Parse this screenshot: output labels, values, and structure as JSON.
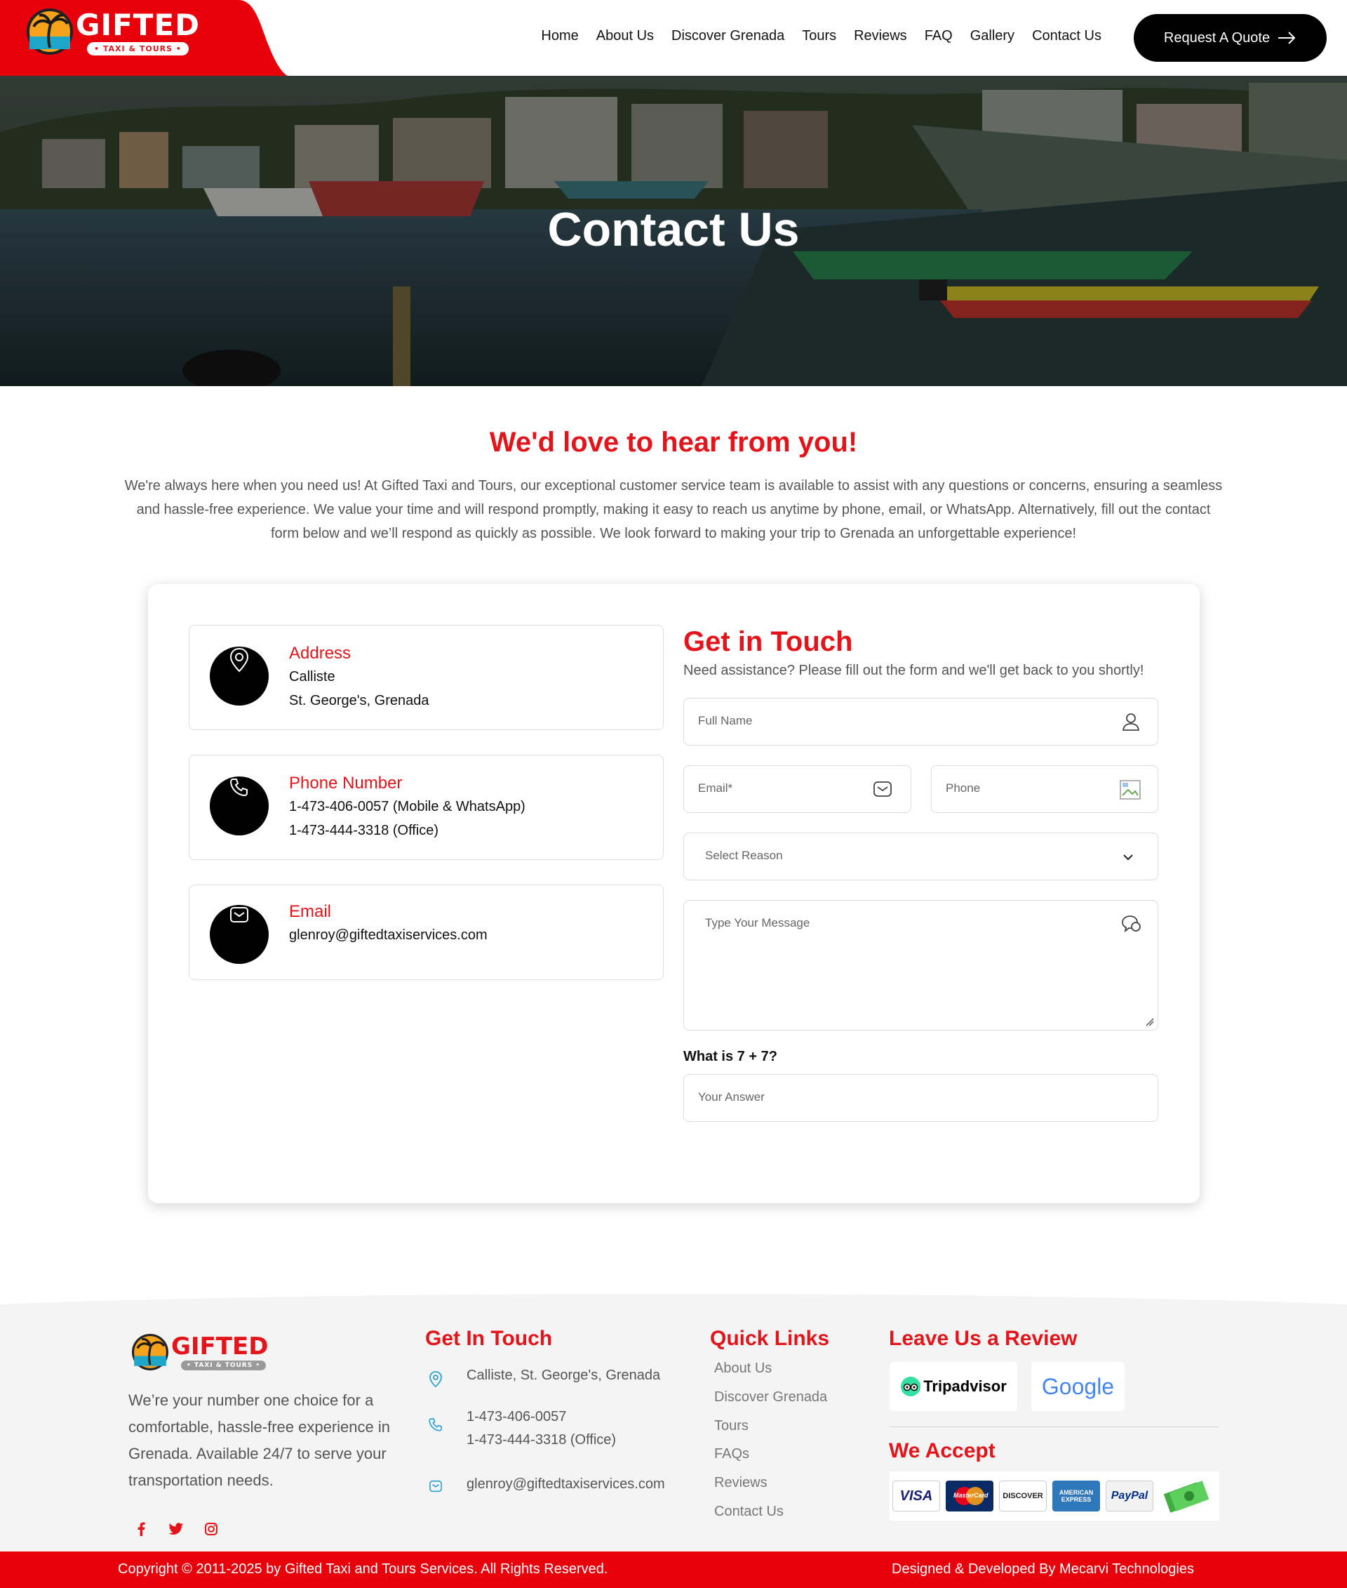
{
  "brand": {
    "name": "GIFTED",
    "tagline": "TAXI & TOURS",
    "accent_color": "#e4141b",
    "dark_color": "#000000"
  },
  "nav": {
    "items": [
      "Home",
      "About Us",
      "Discover Grenada",
      "Tours",
      "Reviews",
      "FAQ",
      "Gallery",
      "Contact Us"
    ],
    "cta_label": "Request A Quote",
    "cta_icon": "arrow-right-icon"
  },
  "hero": {
    "title": "Contact Us"
  },
  "intro": {
    "title": "We'd love to hear from you!",
    "text": "We're always here when you need us! At Gifted Taxi and Tours, our exceptional customer service team is available to assist with any questions or concerns, ensuring a seamless and hassle-free experience. We value your time and will respond promptly, making it easy to reach us anytime by phone, email, or WhatsApp. Alternatively, fill out the contact form below and we’ll respond as quickly as possible. We look forward to making your trip to Grenada an unforgettable experience!"
  },
  "contact_info": {
    "address": {
      "title": "Address",
      "line1": "Calliste",
      "line2": "St. George's, Grenada",
      "icon": "map-pin-icon"
    },
    "phone": {
      "title": "Phone Number",
      "line1": "1-473-406-0057 (Mobile & WhatsApp)",
      "line2": "1-473-444-3318 (Office)",
      "icon": "phone-icon"
    },
    "email": {
      "title": "Email",
      "line1": "glenroy@giftedtaxiservices.com",
      "icon": "mail-icon"
    }
  },
  "form": {
    "title": "Get in Touch",
    "subtitle": "Need assistance? Please fill out the form and we'll get back to you shortly!",
    "full_name_placeholder": "Full Name",
    "email_placeholder": "Email*",
    "phone_placeholder": "Phone",
    "reason_placeholder": "Select Reason",
    "message_placeholder": "Type Your Message",
    "captcha_question": "What is 7 + 7?",
    "captcha_placeholder": "Your Answer"
  },
  "footer": {
    "description": "We’re your number one choice for a comfortable, hassle-free experience in Grenada. Available 24/7 to serve your transportation needs.",
    "get_in_touch_title": "Get In Touch",
    "address": "Calliste, St. George's, Grenada",
    "phone1": "1-473-406-0057",
    "phone2": "1-473-444-3318 (Office)",
    "email": "glenroy@giftedtaxiservices.com",
    "quick_links_title": "Quick Links",
    "quick_links": [
      "About Us",
      "Discover Grenada",
      "Tours",
      "FAQs",
      "Reviews",
      "Contact Us"
    ],
    "review_title": "Leave Us a Review",
    "review_sites": [
      "Tripadvisor",
      "Google"
    ],
    "accept_title": "We Accept",
    "payment_methods": [
      "VISA",
      "MasterCard",
      "DISCOVER",
      "AMERICAN EXPRESS",
      "PayPal"
    ],
    "social_icons": [
      "facebook-icon",
      "twitter-icon",
      "instagram-icon"
    ],
    "copyright": "Copyright © 2011-2025 by Gifted Taxi and Tours Services. All Rights Reserved.",
    "credit": "Designed & Developed By Mecarvi Technologies"
  }
}
